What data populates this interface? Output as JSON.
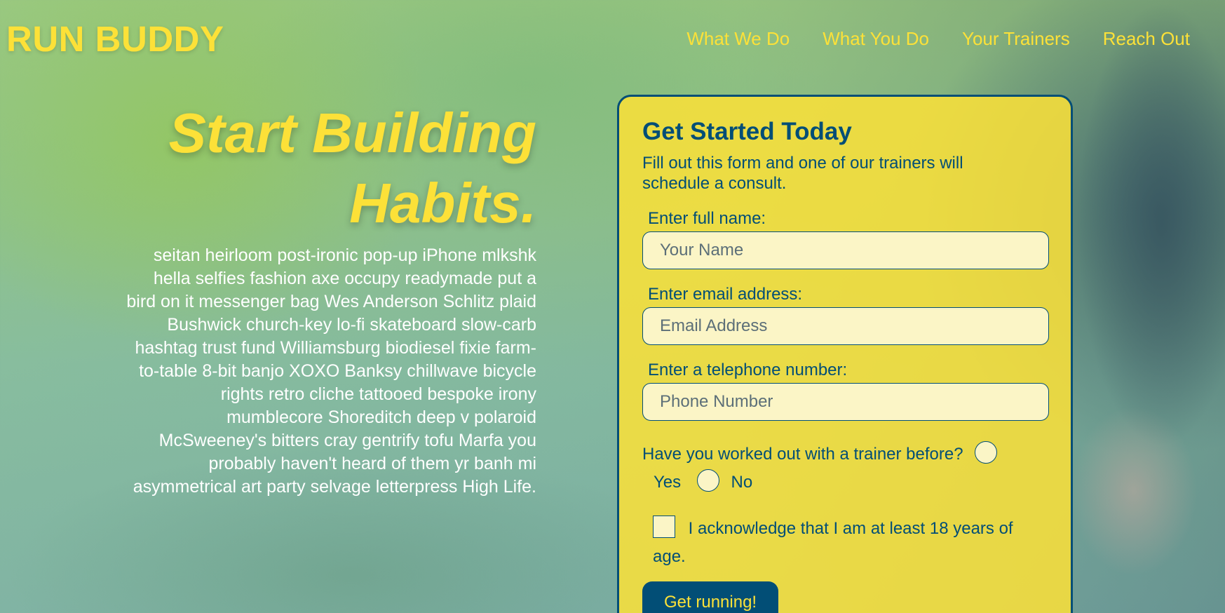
{
  "brand": {
    "logo": "RUN BUDDY"
  },
  "nav": {
    "items": [
      {
        "label": "What We Do"
      },
      {
        "label": "What You Do"
      },
      {
        "label": "Your Trainers"
      },
      {
        "label": "Reach Out"
      }
    ]
  },
  "hero": {
    "title_line1": "Start Building",
    "title_line2": "Habits.",
    "body": "seitan heirloom post-ironic pop-up iPhone mlkshk hella selfies fashion axe occupy readymade put a bird on it messenger bag Wes Anderson Schlitz plaid Bushwick church-key lo-fi skateboard slow-carb hashtag trust fund Williamsburg biodiesel fixie farm-to-table 8-bit banjo XOXO Banksy chillwave bicycle rights retro cliche tattooed bespoke irony mumblecore Shoreditch deep v polaroid McSweeney's bitters cray gentrify tofu Marfa you probably haven't heard of them yr banh mi asymmetrical art party selvage letterpress High Life."
  },
  "form": {
    "title": "Get Started Today",
    "intro": "Fill out this form and one of our trainers will schedule a consult.",
    "name": {
      "label": "Enter full name:",
      "placeholder": "Your Name",
      "value": ""
    },
    "email": {
      "label": "Enter email address:",
      "placeholder": "Email Address",
      "value": ""
    },
    "phone": {
      "label": "Enter a telephone number:",
      "placeholder": "Phone Number",
      "value": ""
    },
    "trainer_question": "Have you worked out with a trainer before?",
    "option_yes": "Yes",
    "option_no": "No",
    "acknowledge": "I acknowledge that I am at least 18 years of age.",
    "submit_label": "Get running!"
  },
  "colors": {
    "brand_yellow": "#fce138",
    "brand_navy": "#024e76",
    "input_bg": "#fbf5c6"
  }
}
